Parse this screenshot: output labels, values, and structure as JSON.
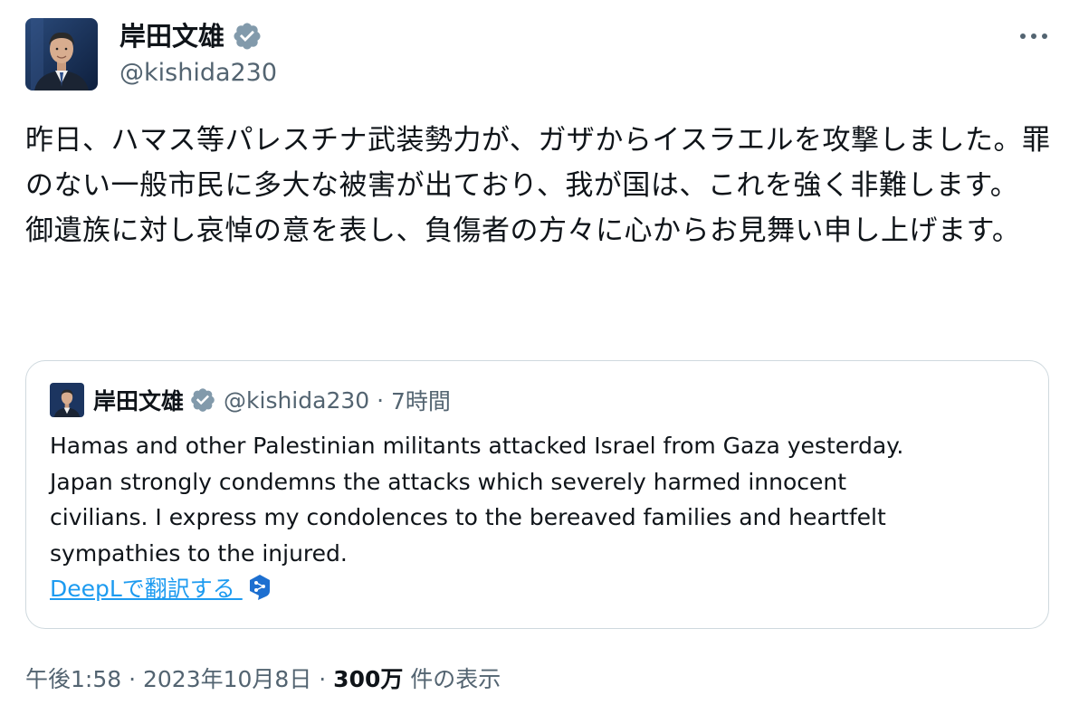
{
  "author": {
    "display_name": "岸田文雄",
    "handle": "@kishida230"
  },
  "tweet": {
    "text": "昨日、ハマス等パレスチナ武装勢力が、ガザからイスラエルを攻撃しました。罪のない一般市民に多大な被害が出ており、我が国は、これを強く非難します。\n御遺族に対し哀悼の意を表し、負傷者の方々に心からお見舞い申し上げます。"
  },
  "quote": {
    "display_name": "岸田文雄",
    "handle": "@kishida230",
    "separator": " · ",
    "time": "7時間",
    "text": "Hamas and other Palestinian militants attacked Israel from Gaza yesterday.\nJapan strongly condemns the attacks which severely harmed innocent\ncivilians. I express my condolences to the bereaved families and heartfelt\nsympathies to the injured.",
    "translate_label": "DeepLで翻訳する "
  },
  "footer": {
    "time": "午後1:58",
    "separator": " · ",
    "date": "2023年10月8日",
    "separator2": " · ",
    "views_count": "300万",
    "views_label": " 件の表示"
  },
  "icons": {
    "verified": "verified-badge-icon",
    "more": "more-options-icon",
    "deepl": "deepl-icon"
  },
  "colors": {
    "text_primary": "#0f1419",
    "text_secondary": "#536471",
    "link": "#1d9bf0",
    "border": "#cfd9de",
    "verified_badge": "#829aab"
  }
}
